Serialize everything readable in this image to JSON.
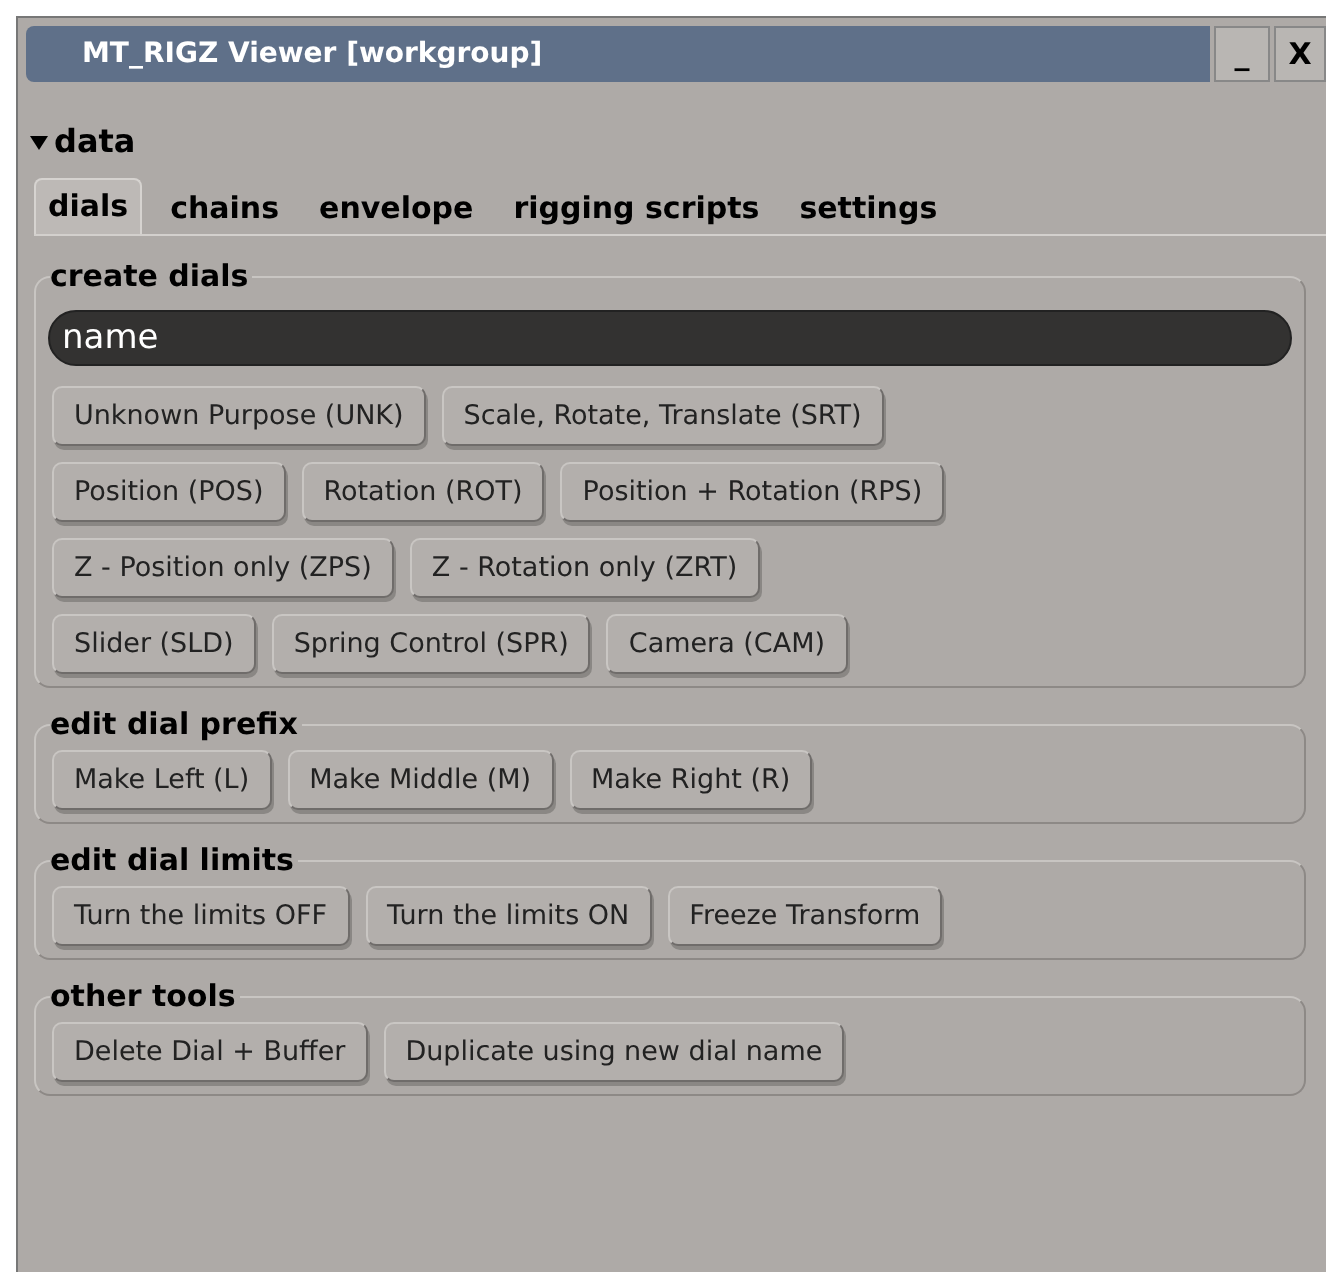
{
  "window": {
    "title": "MT_RIGZ Viewer [workgroup]",
    "minimize": "_",
    "close": "X"
  },
  "section": {
    "label": "data",
    "expanded": true
  },
  "tabs": [
    {
      "label": "dials",
      "selected": true
    },
    {
      "label": "chains",
      "selected": false
    },
    {
      "label": "envelope",
      "selected": false
    },
    {
      "label": "rigging scripts",
      "selected": false
    },
    {
      "label": "settings",
      "selected": false
    }
  ],
  "groups": [
    {
      "title": "create dials",
      "field": {
        "value": "name"
      },
      "rows": [
        [
          "Unknown Purpose (UNK)",
          "Scale, Rotate, Translate (SRT)"
        ],
        [
          "Position (POS)",
          "Rotation (ROT)",
          "Position + Rotation (RPS)"
        ],
        [
          "Z - Position only (ZPS)",
          "Z - Rotation only (ZRT)"
        ],
        [
          "Slider (SLD)",
          "Spring Control (SPR)",
          "Camera (CAM)"
        ]
      ]
    },
    {
      "title": "edit dial prefix",
      "rows": [
        [
          "Make Left (L)",
          "Make Middle (M)",
          "Make Right (R)"
        ]
      ]
    },
    {
      "title": "edit dial limits",
      "rows": [
        [
          "Turn the limits OFF",
          "Turn the limits ON",
          "Freeze Transform"
        ]
      ]
    },
    {
      "title": "other tools",
      "rows": [
        [
          "Delete Dial + Buffer",
          "Duplicate using new dial name"
        ]
      ]
    }
  ]
}
